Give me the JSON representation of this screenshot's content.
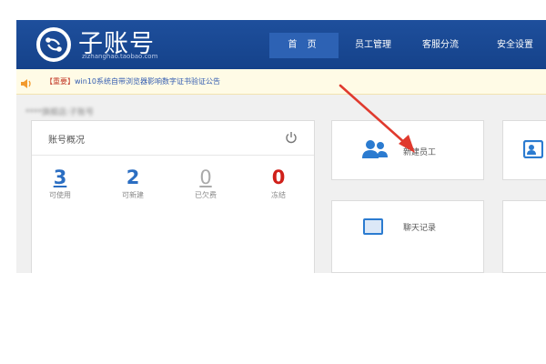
{
  "header": {
    "title": "子账号",
    "subtitle": "zizhanghao.taobao.com",
    "nav": [
      "首 页",
      "员工管理",
      "客服分流",
      "安全设置"
    ]
  },
  "notice": {
    "tag": "【重要】",
    "text": "win10系统自带浏览器影响数字证书验证公告"
  },
  "account_name": "****旗舰店:子账号",
  "overview": {
    "title": "账号概况",
    "stats": [
      {
        "value": "3",
        "label": "可使用",
        "color": "#2b6ec2",
        "underline": true
      },
      {
        "value": "2",
        "label": "可新建",
        "color": "#2b6ec2",
        "underline": false
      },
      {
        "value": "0",
        "label": "已欠费",
        "color": "#aaaaaa",
        "underline": true
      },
      {
        "value": "0",
        "label": "冻结",
        "color": "#d0201a",
        "underline": false
      }
    ]
  },
  "tiles": [
    {
      "label": "新建员工",
      "icon": "users-icon"
    },
    {
      "label": "聊天记录",
      "icon": "chat-log-icon"
    },
    {
      "label": "",
      "icon": "id-card-icon"
    }
  ],
  "colors": {
    "header": "#1a4a96",
    "accent_blue": "#2b6ec2",
    "alert_red": "#d0201a",
    "arrow": "#e03a2e"
  }
}
